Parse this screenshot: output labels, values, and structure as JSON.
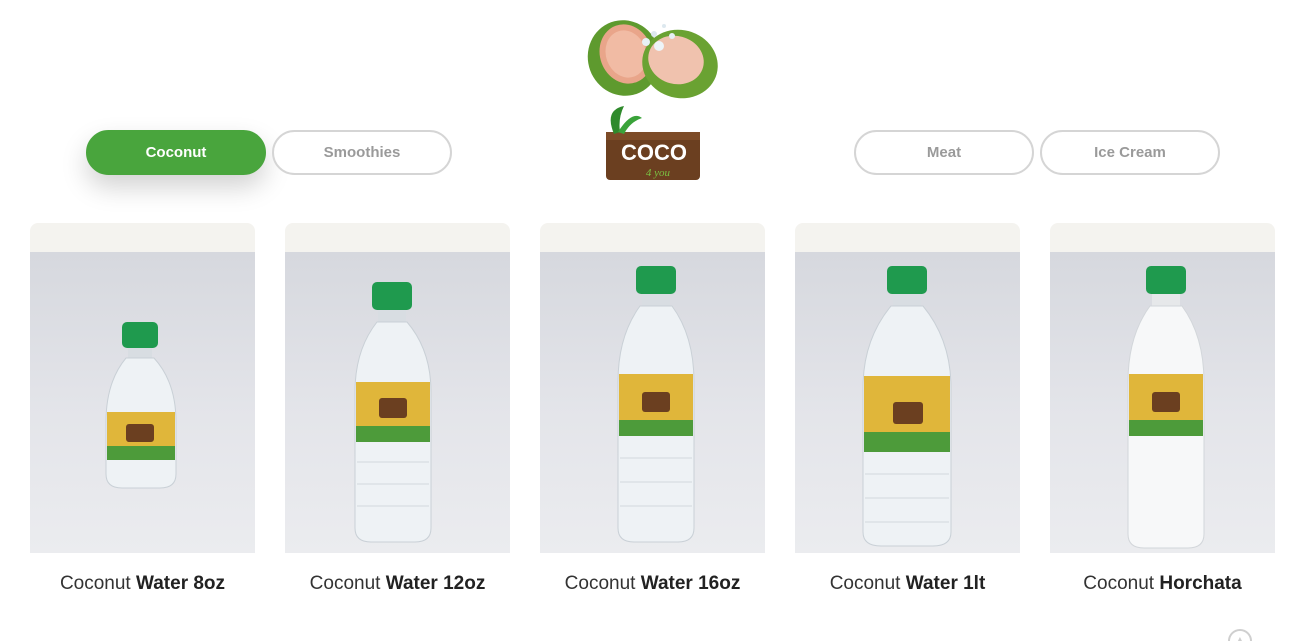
{
  "tabs": [
    {
      "label": "Coconut",
      "active": true
    },
    {
      "label": "Smoothies",
      "active": false
    },
    {
      "label": "Meat",
      "active": false
    },
    {
      "label": "Ice Cream",
      "active": false
    }
  ],
  "logo": {
    "text": "COCO",
    "subtext": "4 you",
    "icon": "coconut-logo-icon"
  },
  "products": [
    {
      "prefix": "Coconut",
      "name": "Water 8oz",
      "image_icon": "bottle-8oz-icon"
    },
    {
      "prefix": "Coconut",
      "name": "Water 12oz",
      "image_icon": "bottle-12oz-icon"
    },
    {
      "prefix": "Coconut",
      "name": "Water 16oz",
      "image_icon": "bottle-16oz-icon"
    },
    {
      "prefix": "Coconut",
      "name": "Water 1lt",
      "image_icon": "bottle-1lt-icon"
    },
    {
      "prefix": "Coconut",
      "name": "Horchata",
      "image_icon": "bottle-horchata-icon"
    }
  ],
  "colors": {
    "accent": "#49a53d",
    "inactive_text": "#9a9a9a",
    "cap": "#1f9a4e"
  }
}
